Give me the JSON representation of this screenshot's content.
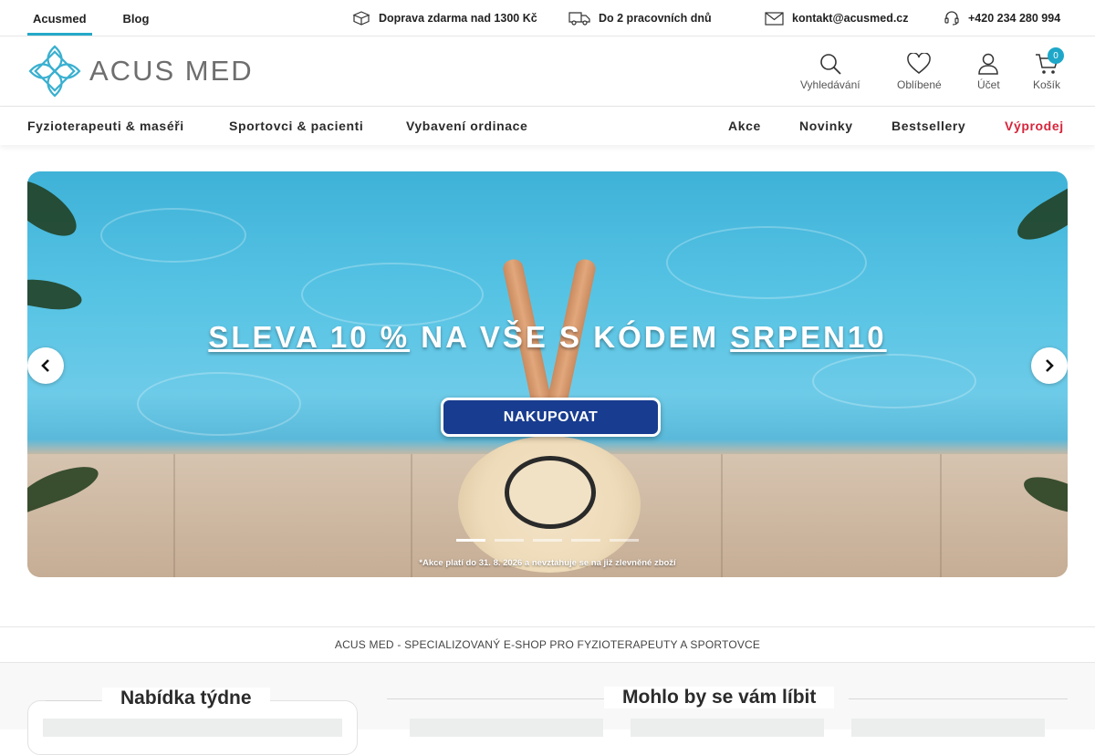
{
  "topbar": {
    "links": [
      {
        "label": "Acusmed",
        "active": true
      },
      {
        "label": "Blog",
        "active": false
      }
    ],
    "shipping": "Doprava zdarma nad 1300 Kč",
    "delivery": "Do 2 pracovních dnů",
    "email": "kontakt@acusmed.cz",
    "phone": "+420 234 280 994"
  },
  "header": {
    "logo_text": "ACUS MED",
    "search_label": "Vyhledávání",
    "favorites_label": "Oblíbené",
    "account_label": "Účet",
    "cart_label": "Košík",
    "cart_count": "0"
  },
  "nav": {
    "left": [
      "Fyzioterapeuti & maséři",
      "Sportovci & pacienti",
      "Vybavení ordinace"
    ],
    "right": [
      "Akce",
      "Novinky",
      "Bestsellery",
      "Výprodej"
    ]
  },
  "banner": {
    "title_part1": "SLEVA 10 %",
    "title_part2": "NA VŠE S KÓDEM",
    "title_part3": "SRPEN10",
    "button_label": "NAKUPOVAT",
    "disclaimer": "*Akce platí do 31. 8. 2026 a nevztahuje se na již zlevněné zboží",
    "slides": 5,
    "active_slide": 1
  },
  "tagline": "ACUS MED - SPECIALIZOVANÝ E-SHOP PRO FYZIOTERAPEUTY A SPORTOVCE",
  "sections": {
    "week_offer": "Nabídka týdne",
    "recommended": "Mohlo by se vám líbit"
  },
  "colors": {
    "accent": "#24a9c9",
    "sale": "#d6243b",
    "button": "#183c8f"
  }
}
